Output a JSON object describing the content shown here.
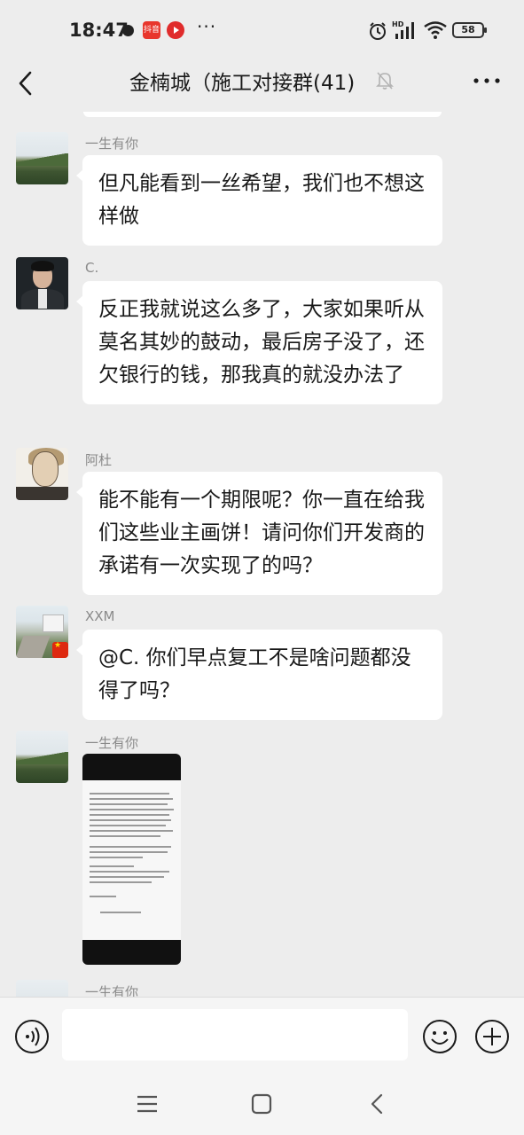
{
  "status_bar": {
    "time": "18:47",
    "app_badge": "抖音",
    "more": "···",
    "battery": "58",
    "icons": [
      "alarm-icon",
      "hd-signal-icon",
      "wifi-icon",
      "battery-icon"
    ]
  },
  "header": {
    "title": "金楠城（施工对接群(41)",
    "icons": [
      "back-icon",
      "mute-bell-icon",
      "more-icon"
    ]
  },
  "messages": [
    {
      "sender": "一生有你",
      "avatar": "landscape",
      "text": "但凡能看到一丝希望，我们也不想这样做"
    },
    {
      "sender": "C.",
      "avatar": "man-in-suit",
      "text": "反正我就说这么多了，大家如果听从莫名其妙的鼓动，最后房子没了，还欠银行的钱，那我真的就没办法了"
    },
    {
      "sender": "阿杜",
      "avatar": "sketch-portrait",
      "text": "能不能有一个期限呢？你一直在给我们这些业主画饼！请问你们开发商的承诺有一次实现了的吗？"
    },
    {
      "sender": "XXM",
      "avatar": "village-road",
      "text": "@C. 你们早点复工不是啥问题都没得了吗？"
    },
    {
      "sender": "一生有你",
      "avatar": "landscape",
      "type": "image",
      "image": "document-screenshot"
    },
    {
      "sender": "一生有你",
      "avatar": "landscape",
      "partial": true
    }
  ],
  "input_bar": {
    "placeholder": "",
    "icons": [
      "voice-icon",
      "emoji-icon",
      "plus-icon"
    ]
  },
  "nav_bar": {
    "icons": [
      "menu-icon",
      "home-icon",
      "nav-back-icon"
    ]
  },
  "colors": {
    "background": "#ededed",
    "bubble": "#ffffff",
    "sender_name": "#8a8a8a"
  }
}
